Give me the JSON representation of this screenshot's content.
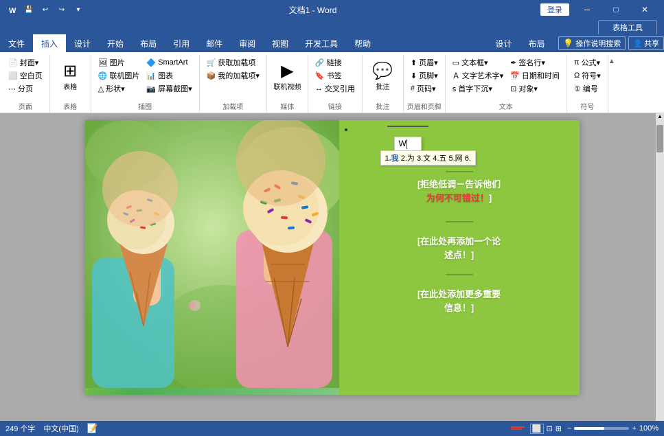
{
  "titleBar": {
    "title": "文档1 - Word",
    "appName": "Word",
    "docName": "文档1",
    "loginBtn": "登录",
    "windowBtns": [
      "─",
      "□",
      "✕"
    ]
  },
  "tableTools": {
    "label": "表格工具"
  },
  "ribbonTabs": {
    "active": "插入",
    "items": [
      "文件",
      "插入",
      "设计",
      "开始",
      "布局",
      "引用",
      "邮件",
      "审阅",
      "视图",
      "开发工具",
      "帮助"
    ]
  },
  "contextTabs": [
    "设计",
    "布局"
  ],
  "toolbar": {
    "searchPlaceholder": "操作说明搜索",
    "shareBtn": "共享"
  },
  "groups": {
    "pages": {
      "label": "页面",
      "items": [
        "封面▾",
        "空白页",
        "分页"
      ]
    },
    "table": {
      "label": "表格",
      "mainBtn": "表格"
    },
    "illustrations": {
      "label": "插图",
      "items": [
        "图片",
        "联机图片",
        "形状▾",
        "SmartArt",
        "图表",
        "屏幕截图▾"
      ]
    },
    "addins": {
      "label": "加载项",
      "items": [
        "获取加载项",
        "我的加载项▾"
      ]
    },
    "media": {
      "label": "媒体",
      "items": [
        "联机视频"
      ]
    },
    "links": {
      "label": "链接",
      "items": [
        "链接",
        "书签",
        "交叉引用"
      ]
    },
    "comments": {
      "label": "批注",
      "mainBtn": "批注"
    },
    "headerFooter": {
      "label": "页眉和页脚",
      "items": [
        "页眉▾",
        "页脚▾",
        "页码▾"
      ]
    },
    "text": {
      "label": "文本",
      "items": [
        "文本框▾",
        "文字艺术字▾",
        "首字下沉▾",
        "签名行▾",
        "日期和时间",
        "对象▾"
      ]
    },
    "symbols": {
      "label": "符号",
      "items": [
        "公式▾",
        "符号▾",
        "编号"
      ]
    }
  },
  "inputPopup": {
    "typed": "W",
    "cursor": "|"
  },
  "autocomplete": {
    "text": "1.我  2.为  3.文  4.五  5.网  6."
  },
  "documentContent": {
    "section1": "[拒绝低调－告诉他们\n为何不可错过！]",
    "section2": "[在此处再添加一个论\n述点！]",
    "section3": "[在此处添加更多重要\n信息！]"
  },
  "statusBar": {
    "wordCount": "249 个字",
    "language": "中文(中国)",
    "zoom": "100%"
  },
  "colors": {
    "accent": "#2b579a",
    "green": "#8dc63f",
    "darkGreen": "#6a9e2f"
  }
}
